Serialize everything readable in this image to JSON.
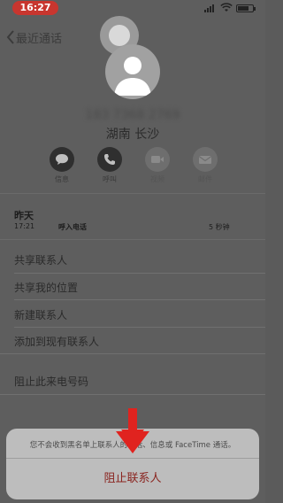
{
  "status_bar": {
    "time": "16:27"
  },
  "nav": {
    "back_label": "最近通话"
  },
  "contact": {
    "phone_number": "183 7368 2769",
    "location": "湖南 长沙"
  },
  "actions": [
    {
      "label": "信息",
      "icon": "message-icon",
      "enabled": true
    },
    {
      "label": "呼叫",
      "icon": "phone-icon",
      "enabled": true
    },
    {
      "label": "视频",
      "icon": "video-icon",
      "enabled": false
    },
    {
      "label": "邮件",
      "icon": "mail-icon",
      "enabled": false
    }
  ],
  "call_history": {
    "heading": "昨天",
    "entries": [
      {
        "time": "17:21",
        "type": "呼入电话",
        "duration": "5 秒钟"
      }
    ]
  },
  "menu": [
    "共享联系人",
    "共享我的位置",
    "新建联系人",
    "添加到现有联系人",
    "阻止此来电号码"
  ],
  "action_sheet": {
    "message": "您不会收到黑名单上联系人的电话、信息或 FaceTime 通话。",
    "block_button": "阻止联系人"
  },
  "colors": {
    "time_pill": "#c8362f",
    "arrow": "#e0231f",
    "block_text": "#8a2520"
  }
}
